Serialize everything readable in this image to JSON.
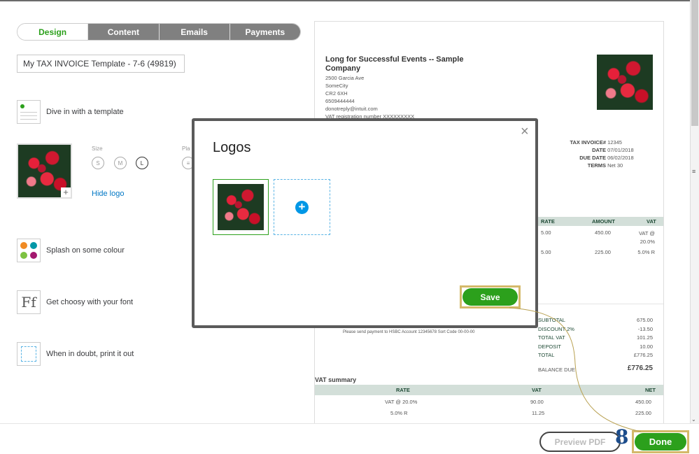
{
  "tabs": [
    {
      "label": "Design",
      "active": true
    },
    {
      "label": "Content"
    },
    {
      "label": "Emails"
    },
    {
      "label": "Payments"
    }
  ],
  "template_name": "My TAX INVOICE Template - 7-6 (49819)",
  "design_items": {
    "template": "Dive in with a template",
    "logo_size_label": "Size",
    "logo_sizes": [
      "S",
      "M",
      "L"
    ],
    "placement_label": "Pla",
    "hide_logo": "Hide logo",
    "colour": "Splash on some colour",
    "font": "Get choosy with your font",
    "font_icon": "Ff",
    "print": "When in doubt, print it out"
  },
  "invoice": {
    "company": "Long for Successful Events -- Sample Company",
    "address": [
      "2500 Garcia Ave",
      "SomeCity",
      "CR2 6XH",
      "6509444444",
      "donotreply@intuit.com",
      "VAT registration number XXXXXXXXX"
    ],
    "meta": [
      {
        "k": "TAX INVOICE#",
        "v": "12345"
      },
      {
        "k": "DATE",
        "v": "07/01/2018"
      },
      {
        "k": "DUE DATE",
        "v": "06/02/2018"
      },
      {
        "k": "TERMS",
        "v": "Net 30"
      }
    ],
    "line_headers": [
      "RATE",
      "AMOUNT",
      "VAT"
    ],
    "lines": [
      {
        "rate": "5.00",
        "amount": "450.00",
        "vat": "VAT @ 20.0%"
      },
      {
        "rate": "5.00",
        "amount": "225.00",
        "vat": "5.0% R"
      }
    ],
    "footnote": "Please send payment to HSBC Account 12345678 Sort Code 00-00-00",
    "totals": [
      {
        "k": "SUBTOTAL",
        "v": "675.00"
      },
      {
        "k": "DISCOUNT 2%",
        "v": "-13.50"
      },
      {
        "k": "TOTAL VAT",
        "v": "101.25"
      },
      {
        "k": "DEPOSIT",
        "v": "10.00"
      },
      {
        "k": "TOTAL",
        "v": "£776.25"
      }
    ],
    "balance_label": "BALANCE DUE",
    "balance": "£776.25",
    "vat_summary_title": "VAT summary",
    "vat_headers": [
      "RATE",
      "VAT",
      "NET"
    ],
    "vat_rows": [
      {
        "rate": "VAT @ 20.0%",
        "vat": "90.00",
        "net": "450.00"
      },
      {
        "rate": "5.0% R",
        "vat": "11.25",
        "net": "225.00"
      }
    ]
  },
  "modal": {
    "title": "Logos",
    "save": "Save"
  },
  "footer": {
    "preview": "Preview PDF",
    "done": "Done"
  },
  "annotation": {
    "step": "8",
    "color": "#d4b96a"
  },
  "colors": {
    "accent": "#2ca01c",
    "link": "#0077c5",
    "add": "#0097e6"
  }
}
